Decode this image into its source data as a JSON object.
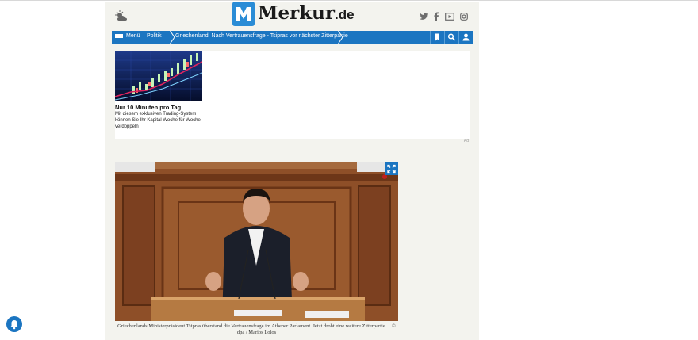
{
  "header": {
    "logo_text": "Merkur",
    "logo_tld": ".de",
    "social_icons": [
      "twitter-icon",
      "facebook-icon",
      "video-icon",
      "instagram-icon"
    ]
  },
  "nav": {
    "menu_label": "Menü",
    "category": "Politik",
    "article_title": "Griechenland: Nach Vertrauensfrage - Tsipras vor nächster Zitterpartie",
    "icons": [
      "bookmark-icon",
      "search-icon",
      "user-icon"
    ]
  },
  "ad": {
    "headline": "Nur 10 Minuten pro Tag",
    "text": "Mit diesem exklusiven Trading-System können Sie Ihr Kapital Woche für Woche verdoppeln",
    "label": "Ad"
  },
  "article": {
    "caption": "Griechenlands Ministerpräsident Tsipras überstand die Vertrauensfrage im Athener Parlament. Jetzt droht eine weitere Zitterpartie.",
    "credit": "© dpa / Marios Lolos"
  },
  "colors": {
    "brand_blue": "#1b75c1",
    "page_bg": "#f3f3ee"
  }
}
